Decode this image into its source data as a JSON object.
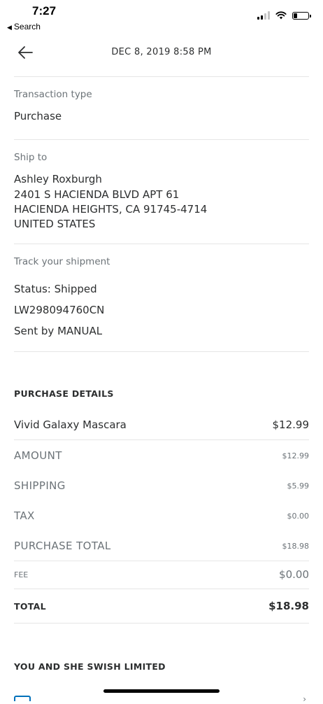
{
  "status_bar": {
    "time": "7:27",
    "back_label": "Search"
  },
  "header": {
    "title": "DEC 8, 2019  8:58 PM"
  },
  "transaction_type": {
    "label": "Transaction type",
    "value": "Purchase"
  },
  "ship_to": {
    "label": "Ship to",
    "lines": [
      "Ashley Roxburgh",
      "2401 S HACIENDA BLVD APT 61",
      "HACIENDA HEIGHTS, CA 91745-4714",
      "UNITED STATES"
    ]
  },
  "tracking": {
    "label": "Track your shipment",
    "status": "Status: Shipped",
    "number": "LW298094760CN",
    "sent_by": "Sent by MANUAL"
  },
  "purchase_details": {
    "heading": "PURCHASE DETAILS",
    "item": {
      "name": "Vivid Galaxy Mascara",
      "price": "$12.99"
    },
    "amount": {
      "label": "AMOUNT",
      "value": "$12.99"
    },
    "shipping": {
      "label": "SHIPPING",
      "value": "$5.99"
    },
    "tax": {
      "label": "TAX",
      "value": "$0.00"
    },
    "purchase_total": {
      "label": "PURCHASE TOTAL",
      "value": "$18.98"
    },
    "fee": {
      "label": "FEE",
      "value": "$0.00"
    },
    "total": {
      "label": "TOTAL",
      "value": "$18.98"
    }
  },
  "merchant": {
    "heading": "YOU AND SHE SWISH LIMITED"
  },
  "colors": {
    "text": "#2c2e2f",
    "muted": "#6c7378",
    "divider": "#e6e6e6",
    "accent": "#0070ba"
  }
}
